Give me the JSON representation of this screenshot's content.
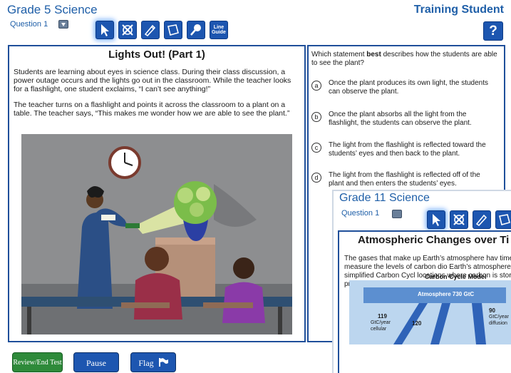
{
  "header": {
    "title": "Grade 5 Science",
    "student": "Training Student",
    "question_label": "Question 1",
    "help_label": "?",
    "line_guide_label_1": "Line",
    "line_guide_label_2": "Guide"
  },
  "passage": {
    "title": "Lights Out! (Part 1)",
    "paragraphs": [
      "Students are learning about eyes in science class. During their class discussion, a power outage occurs and the lights go out in the classroom. While the teacher looks for a flashlight, one student exclaims, “I can’t see anything!”",
      "The teacher turns on a flashlight and points it across the classroom to a plant on a table. The teacher says, “This makes me wonder how we are able to see the plant.”"
    ]
  },
  "question": {
    "stem_pre": "Which statement ",
    "stem_bold": "best",
    "stem_post": " describes how the students are able to see the plant?",
    "choices": [
      {
        "letter": "a",
        "text": "Once the plant produces its own light, the students can observe the plant."
      },
      {
        "letter": "b",
        "text": "Once the plant absorbs all the light from the flashlight, the students can observe the plant."
      },
      {
        "letter": "c",
        "text": "The light from the flashlight is reflected toward the students’ eyes and then back to the plant."
      },
      {
        "letter": "d",
        "text": "The light from the flashlight is reflected off of the plant and then enters the students’ eyes."
      }
    ]
  },
  "overlay": {
    "title": "Grade 11 Science",
    "question_label": "Question 1",
    "passage_title": "Atmospheric Changes over Ti",
    "passage_text": "The gases that make up Earth’s atmosphere hav time. Scientists measure the levels of carbon dio Earth’s atmosphere. The simplified Carbon Cycl locations where carbon is stored and processes from one location to another.",
    "diagram_title": "Carbon Cycle Model",
    "atmosphere_label": "Atmosphere 730 GtC",
    "flow_1_value": "119",
    "flow_1_unit": "GtC/year",
    "flow_1_text": "cellular",
    "flow_2_value": "120",
    "flow_3_value": "90",
    "flow_3_unit": "GtC/year",
    "flow_3_text": "diffusion"
  },
  "footer": {
    "review_label": "Review/End Test",
    "pause_label": "Pause",
    "flag_label": "Flag"
  },
  "colors": {
    "brand_blue": "#1d56b0",
    "title_blue": "#1f5fa8",
    "review_green": "#2e8a3a"
  },
  "icons": [
    "pointer-icon",
    "eliminator-icon",
    "highlighter-icon",
    "notepad-icon",
    "magnifier-icon",
    "line-guide-icon",
    "help-icon",
    "flag-icon"
  ]
}
